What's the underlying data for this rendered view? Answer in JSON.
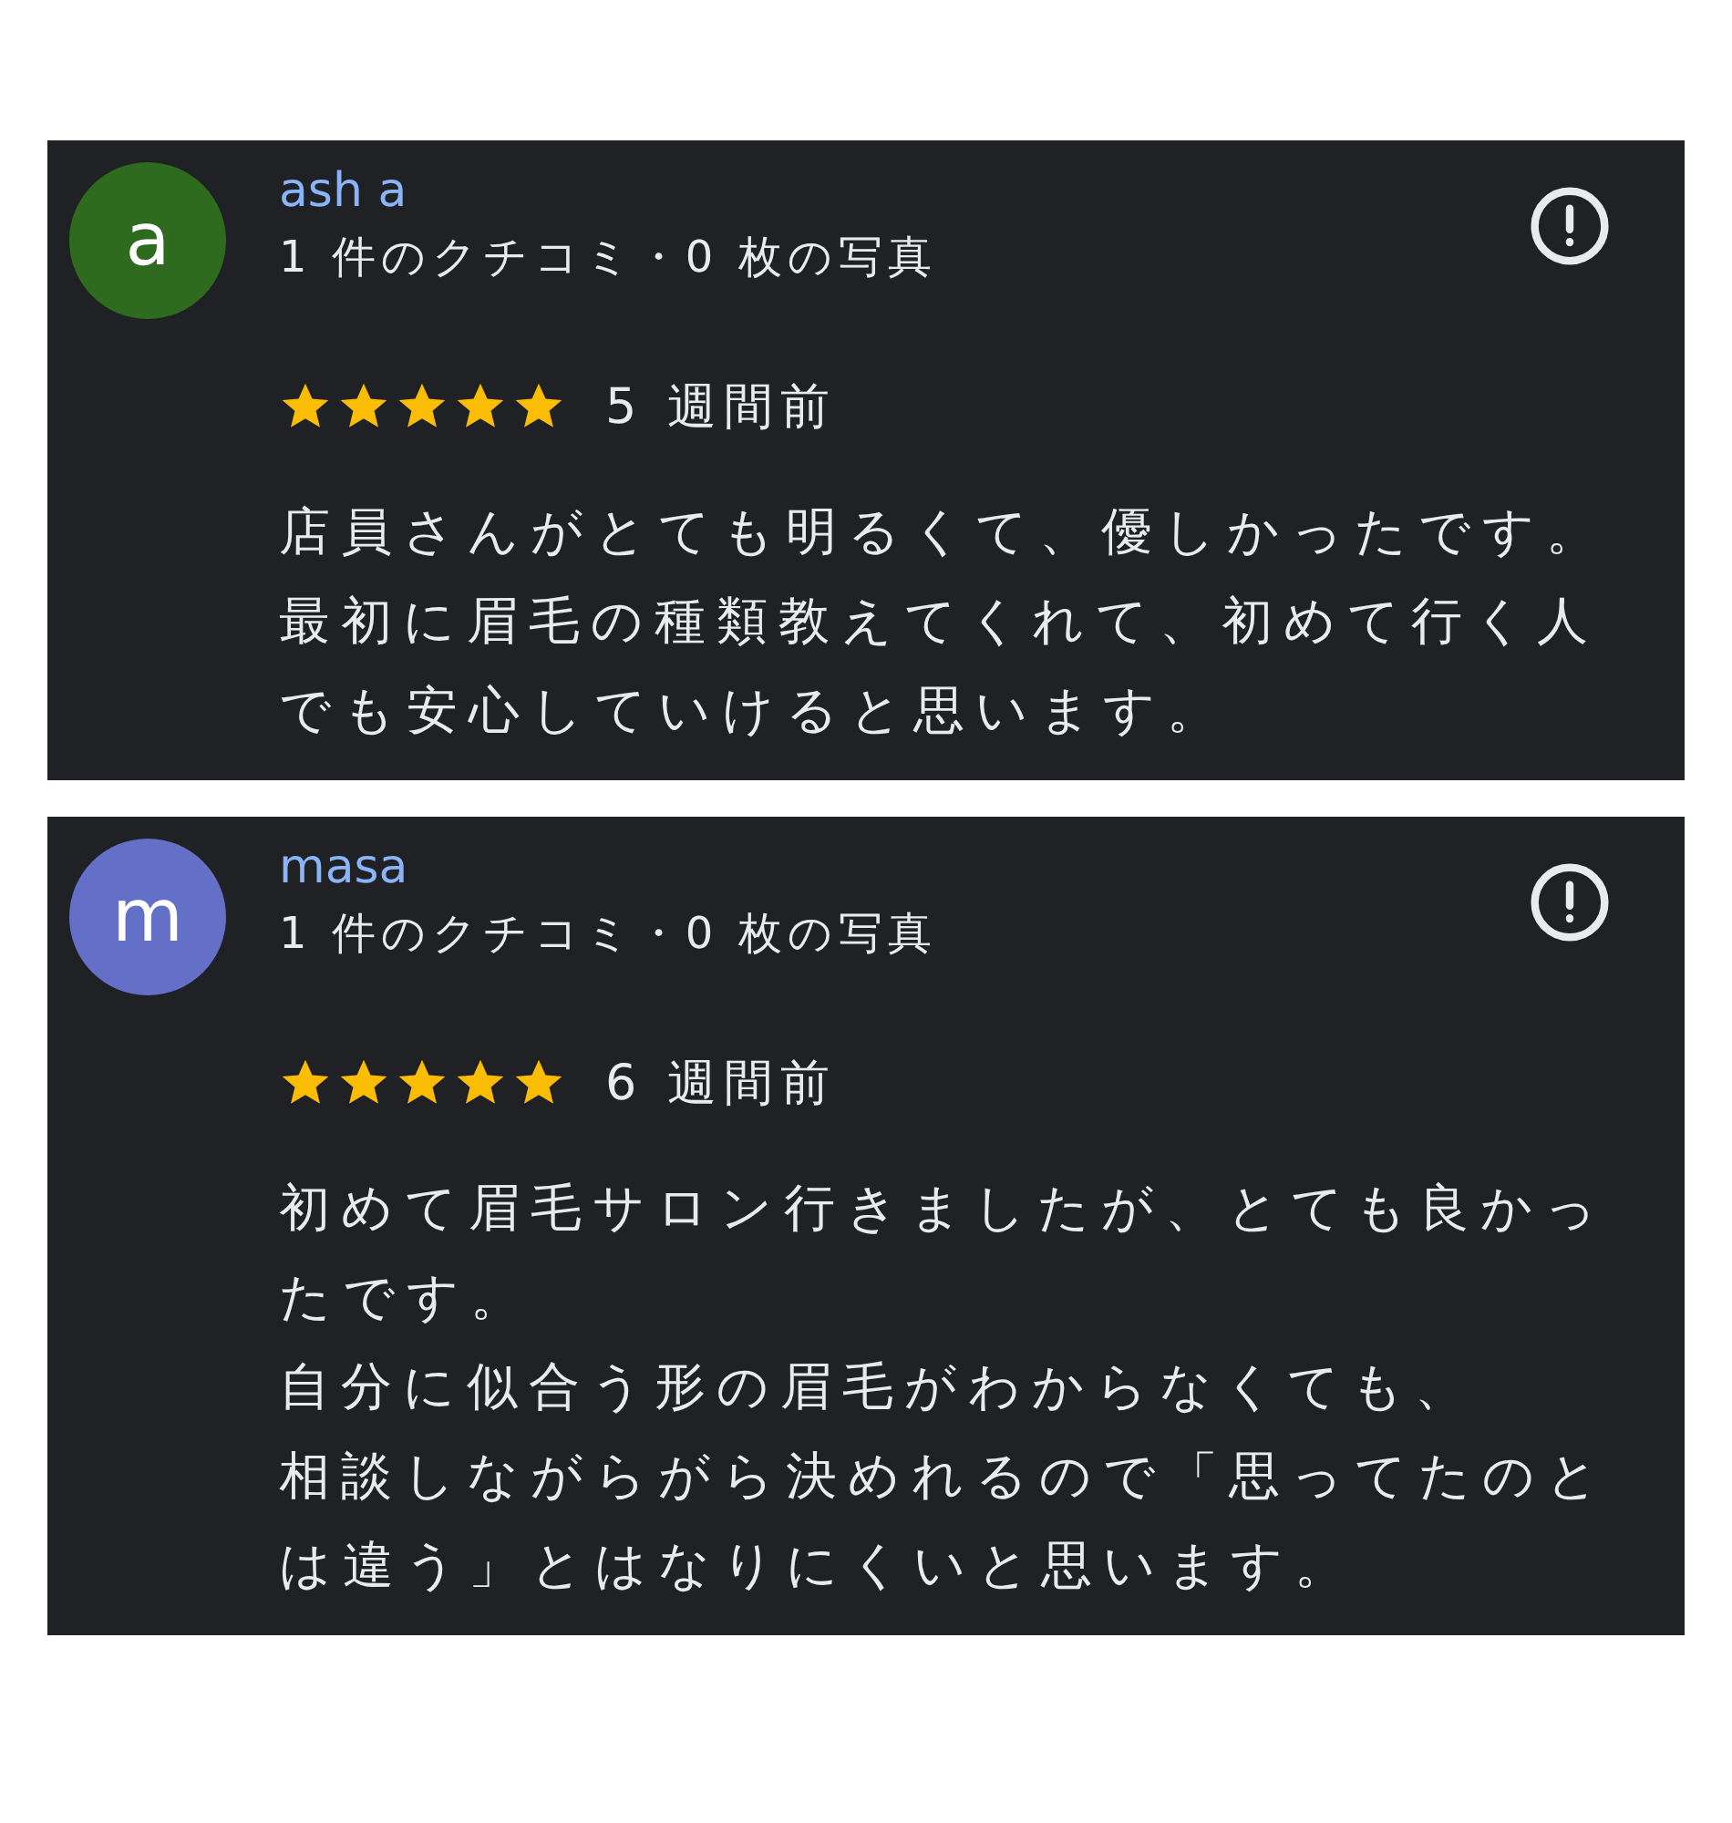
{
  "reviews": [
    {
      "avatar": {
        "letter": "a",
        "color": "#2e6b1e"
      },
      "name": "ash a",
      "meta": "1 件のクチコミ・0 枚の写真",
      "stars": 5,
      "time": "5 週間前",
      "paragraphs": [
        "店員さんがとても明るくて、優しかったです。最初に眉毛の種類教えてくれて、初めて行く人でも安心していけると思います。"
      ]
    },
    {
      "avatar": {
        "letter": "m",
        "color": "#6470c8"
      },
      "name": "masa",
      "meta": "1 件のクチコミ・0 枚の写真",
      "stars": 5,
      "time": "6 週間前",
      "paragraphs": [
        "初めて眉毛サロン行きましたが、とても良かったです。",
        "自分に似合う形の眉毛がわからなくても、",
        "相談しながらがら決めれるので「思ってたのとは違う」とはなりにくいと思います。"
      ]
    }
  ]
}
